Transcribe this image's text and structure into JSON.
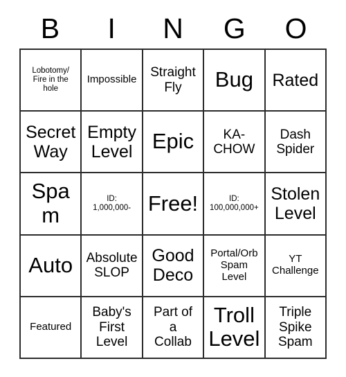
{
  "card": {
    "header_letters": [
      "B",
      "I",
      "N",
      "G",
      "O"
    ],
    "rows": [
      [
        {
          "text": "Lobotomy/\nFire in the\nhole",
          "size": "xs"
        },
        {
          "text": "Impossible",
          "size": "sm"
        },
        {
          "text": "Straight\nFly",
          "size": "md"
        },
        {
          "text": "Bug",
          "size": "xl"
        },
        {
          "text": "Rated",
          "size": "lg"
        }
      ],
      [
        {
          "text": "Secret\nWay",
          "size": "lg"
        },
        {
          "text": "Empty\nLevel",
          "size": "lg"
        },
        {
          "text": "Epic",
          "size": "xl"
        },
        {
          "text": "KA-\nCHOW",
          "size": "md"
        },
        {
          "text": "Dash\nSpider",
          "size": "md"
        }
      ],
      [
        {
          "text": "Spam",
          "size": "xl"
        },
        {
          "text": "ID:\n1,000,000-",
          "size": "xs"
        },
        {
          "text": "Free!",
          "size": "xl"
        },
        {
          "text": "ID:\n100,000,000+",
          "size": "xs"
        },
        {
          "text": "Stolen\nLevel",
          "size": "lg"
        }
      ],
      [
        {
          "text": "Auto",
          "size": "xl"
        },
        {
          "text": "Absolute\nSLOP",
          "size": "md"
        },
        {
          "text": "Good\nDeco",
          "size": "lg"
        },
        {
          "text": "Portal/Orb\nSpam\nLevel",
          "size": "sm"
        },
        {
          "text": "YT\nChallenge",
          "size": "sm"
        }
      ],
      [
        {
          "text": "Featured",
          "size": "sm"
        },
        {
          "text": "Baby's\nFirst\nLevel",
          "size": "md"
        },
        {
          "text": "Part of\na\nCollab",
          "size": "md"
        },
        {
          "text": "Troll\nLevel",
          "size": "xl"
        },
        {
          "text": "Triple\nSpike\nSpam",
          "size": "md"
        }
      ]
    ],
    "colors": {
      "background": "#ffffff",
      "border": "#2b2b2b",
      "text": "#000000"
    }
  }
}
